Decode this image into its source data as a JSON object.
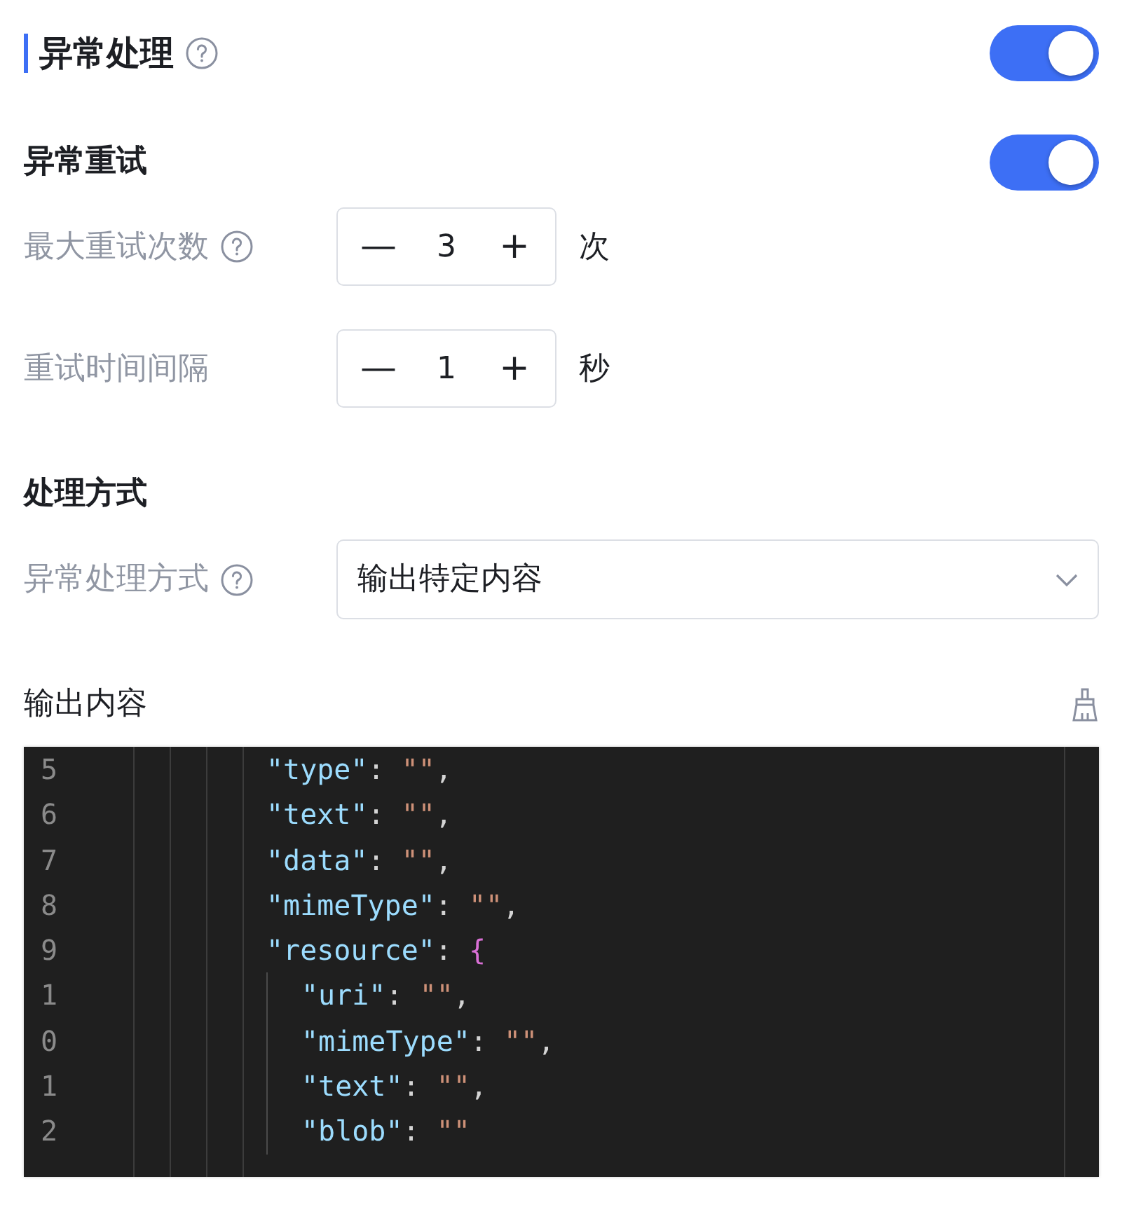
{
  "section": {
    "title": "异常处理",
    "help": true,
    "enabled": true
  },
  "retry": {
    "title": "异常重试",
    "enabled": true,
    "fields": [
      {
        "label": "最大重试次数",
        "help": true,
        "decrement": "—",
        "value": "3",
        "increment": "+",
        "unit": "次"
      },
      {
        "label": "重试时间间隔",
        "help": false,
        "decrement": "—",
        "value": "1",
        "increment": "+",
        "unit": "秒"
      }
    ]
  },
  "handling": {
    "title": "处理方式",
    "label": "异常处理方式",
    "help": true,
    "value": "输出特定内容"
  },
  "output": {
    "title": "输出内容",
    "gutter": [
      "5",
      "6",
      "7",
      "8",
      "9",
      "1",
      "0",
      "1",
      "2"
    ],
    "lines": [
      {
        "tokens": [
          {
            "kind": "key",
            "text": "\"type\""
          },
          {
            "kind": "punct",
            "text": ": "
          },
          {
            "kind": "string",
            "text": "\"\""
          },
          {
            "kind": "punct",
            "text": ","
          }
        ]
      },
      {
        "tokens": [
          {
            "kind": "key",
            "text": "\"text\""
          },
          {
            "kind": "punct",
            "text": ": "
          },
          {
            "kind": "string",
            "text": "\"\""
          },
          {
            "kind": "punct",
            "text": ","
          }
        ]
      },
      {
        "tokens": [
          {
            "kind": "key",
            "text": "\"data\""
          },
          {
            "kind": "punct",
            "text": ": "
          },
          {
            "kind": "string",
            "text": "\"\""
          },
          {
            "kind": "punct",
            "text": ","
          }
        ]
      },
      {
        "tokens": [
          {
            "kind": "key",
            "text": "\"mimeType\""
          },
          {
            "kind": "punct",
            "text": ": "
          },
          {
            "kind": "string",
            "text": "\"\""
          },
          {
            "kind": "punct",
            "text": ","
          }
        ]
      },
      {
        "tokens": [
          {
            "kind": "key",
            "text": "\"resource\""
          },
          {
            "kind": "punct",
            "text": ": "
          },
          {
            "kind": "brace",
            "text": "{"
          }
        ],
        "children": [
          {
            "tokens": [
              {
                "kind": "key",
                "text": "\"uri\""
              },
              {
                "kind": "punct",
                "text": ": "
              },
              {
                "kind": "string",
                "text": "\"\""
              },
              {
                "kind": "punct",
                "text": ","
              }
            ]
          },
          {
            "tokens": [
              {
                "kind": "key",
                "text": "\"mimeType\""
              },
              {
                "kind": "punct",
                "text": ": "
              },
              {
                "kind": "string",
                "text": "\"\""
              },
              {
                "kind": "punct",
                "text": ","
              }
            ]
          },
          {
            "tokens": [
              {
                "kind": "key",
                "text": "\"text\""
              },
              {
                "kind": "punct",
                "text": ": "
              },
              {
                "kind": "string",
                "text": "\"\""
              },
              {
                "kind": "punct",
                "text": ","
              }
            ]
          },
          {
            "tokens": [
              {
                "kind": "key",
                "text": "\"blob\""
              },
              {
                "kind": "punct",
                "text": ": "
              },
              {
                "kind": "string",
                "text": "\"\""
              }
            ]
          }
        ]
      }
    ]
  }
}
